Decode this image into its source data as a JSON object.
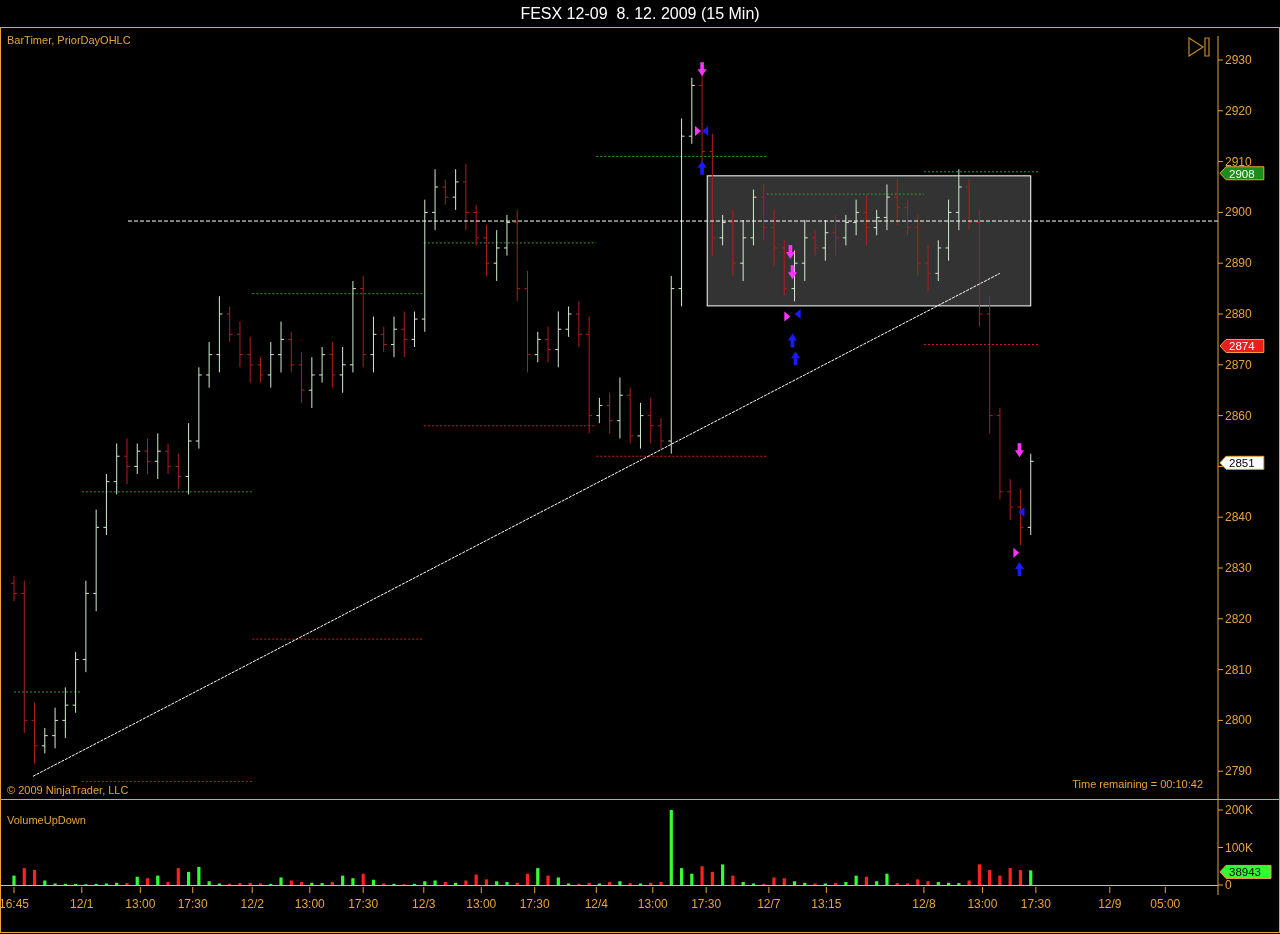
{
  "window": {
    "title": "FESX 12-09  8. 12. 2009 (15 Min)"
  },
  "price_panel": {
    "indicators_label": "BarTimer, PriorDayOHLC",
    "copyright": "© 2009 NinjaTrader, LLC",
    "bar_timer": "Time remaining = 00:10:42",
    "axis_labels": [
      "2930",
      "2920",
      "2910",
      "2900",
      "2890",
      "2880",
      "2870",
      "2860",
      "2840",
      "2830",
      "2820",
      "2810",
      "2800",
      "2790"
    ],
    "price_tags": [
      {
        "label": "2908",
        "color": "#1c8c1c"
      },
      {
        "label": "2874",
        "color": "#ee1c1c"
      },
      {
        "label": "2851",
        "color": "#ffffff"
      }
    ]
  },
  "volume_panel": {
    "label": "VolumeUpDown",
    "axis_labels": [
      "200K",
      "100K",
      "0"
    ],
    "volume_tag": {
      "label": "38943",
      "color": "#33ff33"
    }
  },
  "time_axis": {
    "labels": [
      "16:45",
      "12/1",
      "13:00",
      "17:30",
      "12/2",
      "13:00",
      "17:30",
      "12/3",
      "13:00",
      "17:30",
      "12/4",
      "13:00",
      "17:30",
      "12/7",
      "13:15",
      "12/8",
      "13:00",
      "17:30",
      "12/9",
      "05:00"
    ]
  }
}
